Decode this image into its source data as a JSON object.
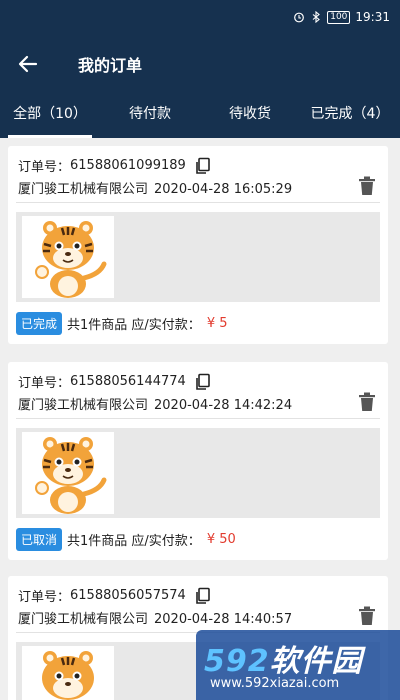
{
  "status_bar": {
    "battery": "100",
    "time": "19:31",
    "icons": [
      "alarm-icon",
      "bluetooth-icon",
      "battery-icon"
    ]
  },
  "header": {
    "back_icon": "back-arrow-icon",
    "title": "我的订单"
  },
  "tabs": [
    {
      "label": "全部（10）",
      "active": true
    },
    {
      "label": "待付款",
      "active": false
    },
    {
      "label": "待收货",
      "active": false
    },
    {
      "label": "已完成（4）",
      "active": false
    }
  ],
  "orders": [
    {
      "order_label": "订单号：",
      "order_no": "61588061099189",
      "company": "厦门骏工机械有限公司",
      "datetime": "2020-04-28 16:05:29",
      "status": "已完成",
      "summary": "共1件商品 应/实付款：",
      "price": "¥ 5"
    },
    {
      "order_label": "订单号：",
      "order_no": "61588056144774",
      "company": "厦门骏工机械有限公司",
      "datetime": "2020-04-28 14:42:24",
      "status": "已取消",
      "summary": "共1件商品 应/实付款：",
      "price": "¥ 50"
    },
    {
      "order_label": "订单号：",
      "order_no": "61588056057574",
      "company": "厦门骏工机械有限公司",
      "datetime": "2020-04-28 14:40:57",
      "status": "",
      "summary": "",
      "price": ""
    }
  ],
  "watermark": {
    "logo_num": "592",
    "logo_text": "软件园",
    "url": "www.592xiazai.com"
  },
  "colors": {
    "header_bg": "#16314f",
    "badge": "#2a8de0",
    "price": "#e23b2e",
    "page_bg": "#efefef"
  }
}
